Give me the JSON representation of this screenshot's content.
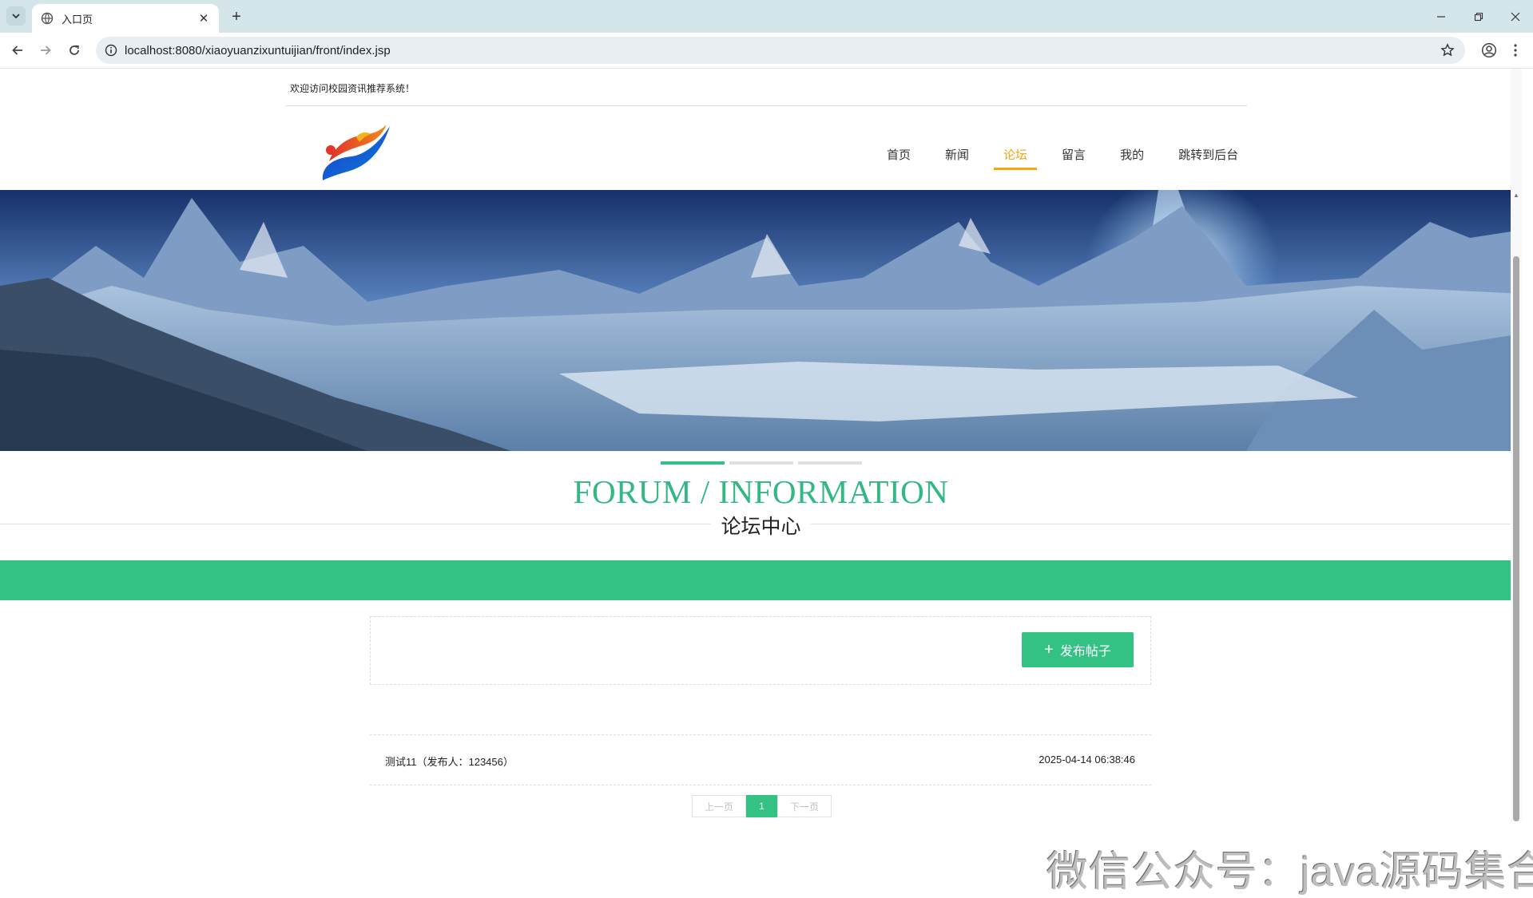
{
  "browser": {
    "tab_title": "入口页",
    "url": "localhost:8080/xiaoyuanzixuntuijian/front/index.jsp"
  },
  "header": {
    "welcome": "欢迎访问校园资讯推荐系统！",
    "nav": [
      {
        "label": "首页",
        "active": false
      },
      {
        "label": "新闻",
        "active": false
      },
      {
        "label": "论坛",
        "active": true
      },
      {
        "label": "留言",
        "active": false
      },
      {
        "label": "我的",
        "active": false
      },
      {
        "label": "跳转到后台",
        "active": false
      }
    ]
  },
  "carousel": {
    "slides": 3,
    "active_index": 0
  },
  "section": {
    "title_en": "FORUM / INFORMATION",
    "title_cn": "论坛中心"
  },
  "toolbar": {
    "post_button": "发布帖子"
  },
  "posts": [
    {
      "title": "测试11（发布人：123456）",
      "time": "2025-04-14 06:38:46"
    }
  ],
  "pagination": {
    "prev": "上一页",
    "current": "1",
    "next": "下一页"
  },
  "watermark": "微信公众号：java源码集合",
  "colors": {
    "accent": "#33c283",
    "nav_active": "#f5a70e",
    "tabstrip": "#d4e6ea"
  }
}
